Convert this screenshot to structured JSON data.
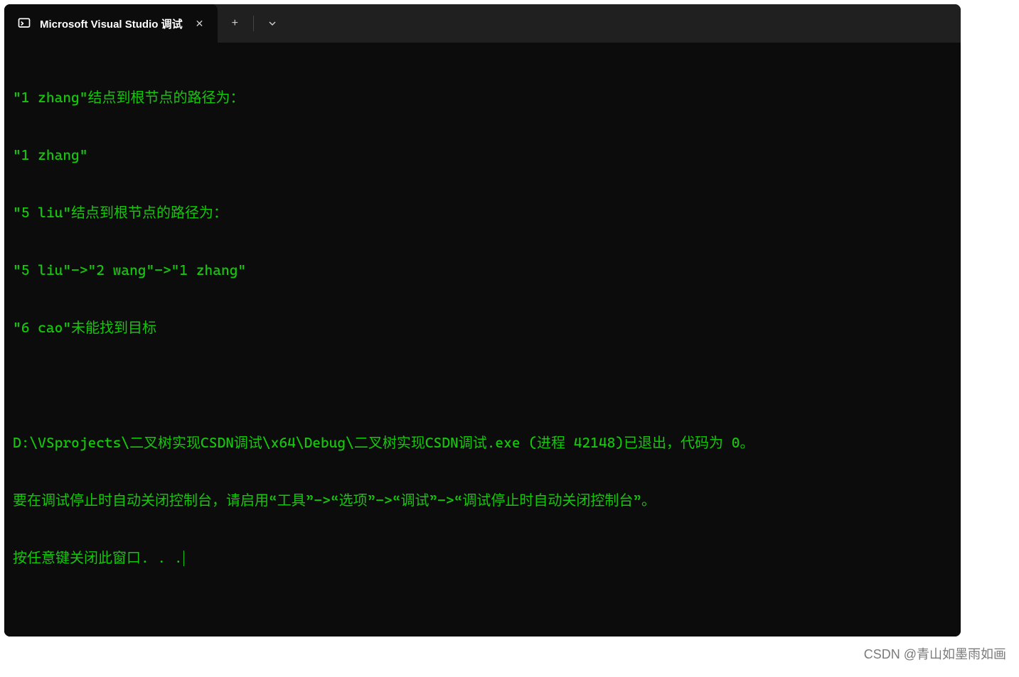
{
  "titlebar": {
    "tab_title": "Microsoft Visual Studio 调试",
    "new_tab_label": "+",
    "dropdown_label": "⌄",
    "close_label": "✕"
  },
  "terminal": {
    "lines": [
      "\"1 zhang\"结点到根节点的路径为：",
      "\"1 zhang\"",
      "\"5 liu\"结点到根节点的路径为：",
      "\"5 liu\"->\"2 wang\"->\"1 zhang\"",
      "\"6 cao\"未能找到目标"
    ],
    "status_lines": [
      "D:\\VSprojects\\二叉树实现CSDN调试\\x64\\Debug\\二叉树实现CSDN调试.exe (进程 42148)已退出，代码为 0。",
      "要在调试停止时自动关闭控制台，请启用“工具”->“选项”->“调试”->“调试停止时自动关闭控制台”。",
      "按任意键关闭此窗口. . ."
    ]
  },
  "watermark": "CSDN @青山如墨雨如画"
}
